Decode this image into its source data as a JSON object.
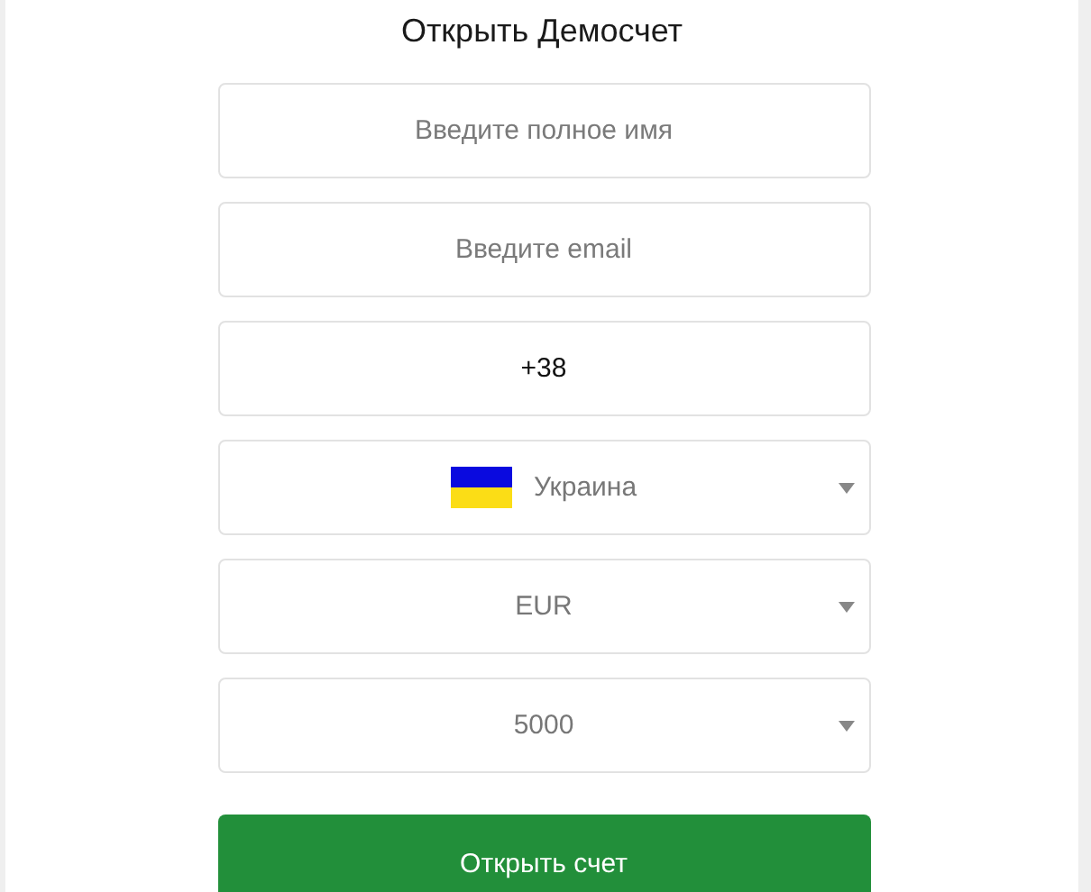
{
  "title": "Открыть Демосчет",
  "fields": [
    {
      "kind": "input",
      "placeholder": "Введите полное имя"
    },
    {
      "kind": "input",
      "placeholder": "Введите email"
    },
    {
      "kind": "input",
      "value": "+38"
    },
    {
      "kind": "country-select",
      "value": "Украина"
    },
    {
      "kind": "select",
      "value": "EUR"
    },
    {
      "kind": "select",
      "value": "5000"
    }
  ],
  "submit": {
    "label": "Открыть счет"
  }
}
